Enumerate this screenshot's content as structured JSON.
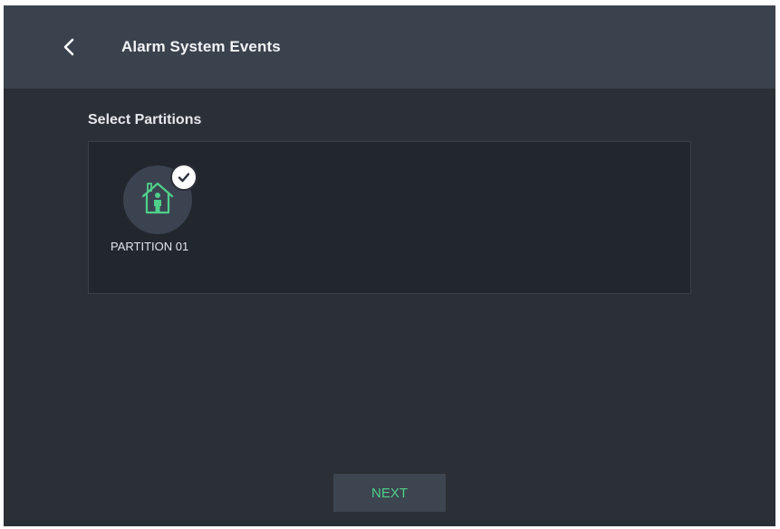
{
  "header": {
    "title": "Alarm System Events",
    "back_icon": "chevron-left-icon"
  },
  "main": {
    "section_label": "Select Partitions",
    "partitions": [
      {
        "name": "PARTITION 01",
        "icon": "house-person-icon",
        "selected": true,
        "badge_icon": "check-icon"
      }
    ]
  },
  "footer": {
    "next_label": "NEXT"
  },
  "colors": {
    "background": "#2b2f36",
    "header": "#3a424d",
    "panel": "#22262d",
    "accent_green": "#4fd08a",
    "text": "#f2f4f6"
  }
}
